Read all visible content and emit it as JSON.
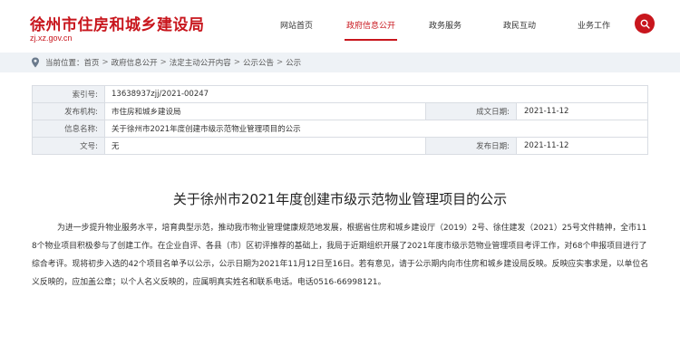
{
  "header": {
    "site_title": "徐州市住房和城乡建设局",
    "domain": "zj.xz.gov.cn",
    "nav": [
      {
        "label": "网站首页"
      },
      {
        "label": "政府信息公开"
      },
      {
        "label": "政务服务"
      },
      {
        "label": "政民互动"
      },
      {
        "label": "业务工作"
      }
    ],
    "active_nav_index": 1,
    "accent_color": "#c8161d"
  },
  "breadcrumb": {
    "prefix": "当前位置：",
    "items": [
      "首页",
      "政府信息公开",
      "法定主动公开内容",
      "公示公告",
      "公示"
    ],
    "separator": ">"
  },
  "meta": {
    "index_label": "索引号:",
    "index_value": "13638937zjj/2021-00247",
    "publisher_label": "发布机构:",
    "publisher_value": "市住房和城乡建设局",
    "created_label": "成文日期:",
    "created_value": "2021-11-12",
    "name_label": "信息名称:",
    "name_value": "关于徐州市2021年度创建市级示范物业管理项目的公示",
    "docno_label": "文号:",
    "docno_value": "无",
    "published_label": "发布日期:",
    "published_value": "2021-11-12"
  },
  "article": {
    "title": "关于徐州市2021年度创建市级示范物业管理项目的公示",
    "body": "为进一步提升物业服务水平，培育典型示范，推动我市物业管理健康规范地发展，根据省住房和城乡建设厅（2019）2号、徐住建发（2021）25号文件精神，全市118个物业项目积极参与了创建工作。在企业自评、各县（市）区初评推荐的基础上，我局于近期组织开展了2021年度市级示范物业管理项目考评工作，对68个申报项目进行了综合考评。现将初步入选的42个项目名单予以公示，公示日期为2021年11月12日至16日。若有意见，请于公示期内向市住房和城乡建设局反映。反映应实事求是，以单位名义反映的，应加盖公章；以个人名义反映的，应属明真实姓名和联系电话。电话0516-66998121。"
  }
}
